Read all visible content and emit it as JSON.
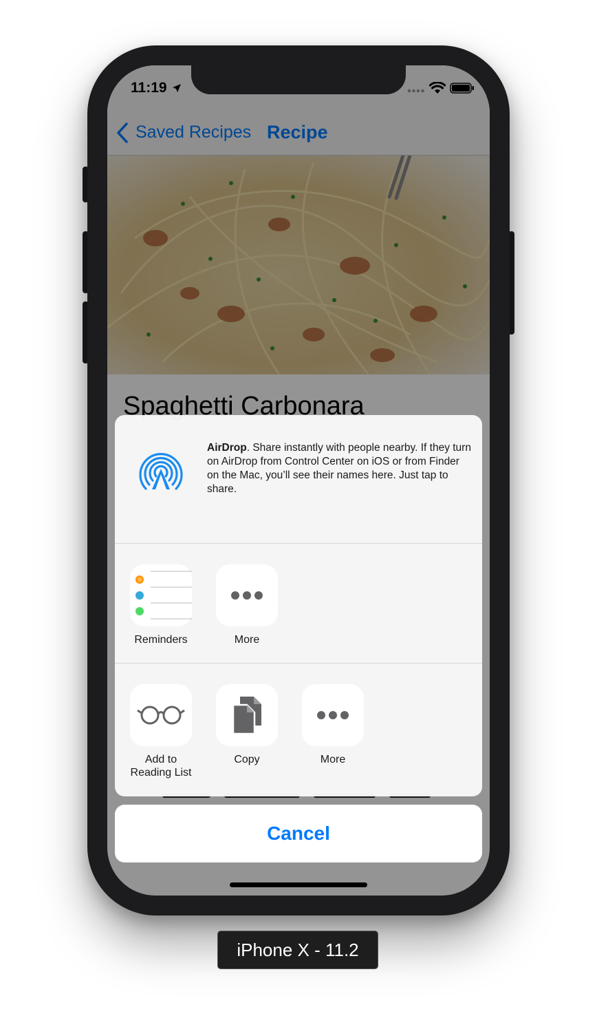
{
  "status_bar": {
    "time": "11:19"
  },
  "nav": {
    "back_label": "Saved Recipes",
    "title": "Recipe"
  },
  "recipe": {
    "title": "Spaghetti Carbonara"
  },
  "share_sheet": {
    "airdrop_title": "AirDrop",
    "airdrop_text": ". Share instantly with people nearby. If they turn on AirDrop from Control Center on iOS or from Finder on the Mac, you’ll see their names here. Just tap to share.",
    "apps": [
      {
        "label": "Reminders",
        "icon": "reminders-icon"
      },
      {
        "label": "More",
        "icon": "more-icon"
      }
    ],
    "actions": [
      {
        "label_line1": "Add to",
        "label_line2": "Reading List",
        "icon": "glasses-icon"
      },
      {
        "label": "Copy",
        "icon": "copy-icon"
      },
      {
        "label": "More",
        "icon": "more-icon"
      }
    ],
    "cancel_label": "Cancel"
  },
  "device_label": "iPhone X - 11.2",
  "colors": {
    "accent": "#007aff",
    "airdrop": "#1a8cf0",
    "reminder_orange": "#ff9500",
    "reminder_blue": "#34aadc",
    "reminder_green": "#4cd964"
  }
}
